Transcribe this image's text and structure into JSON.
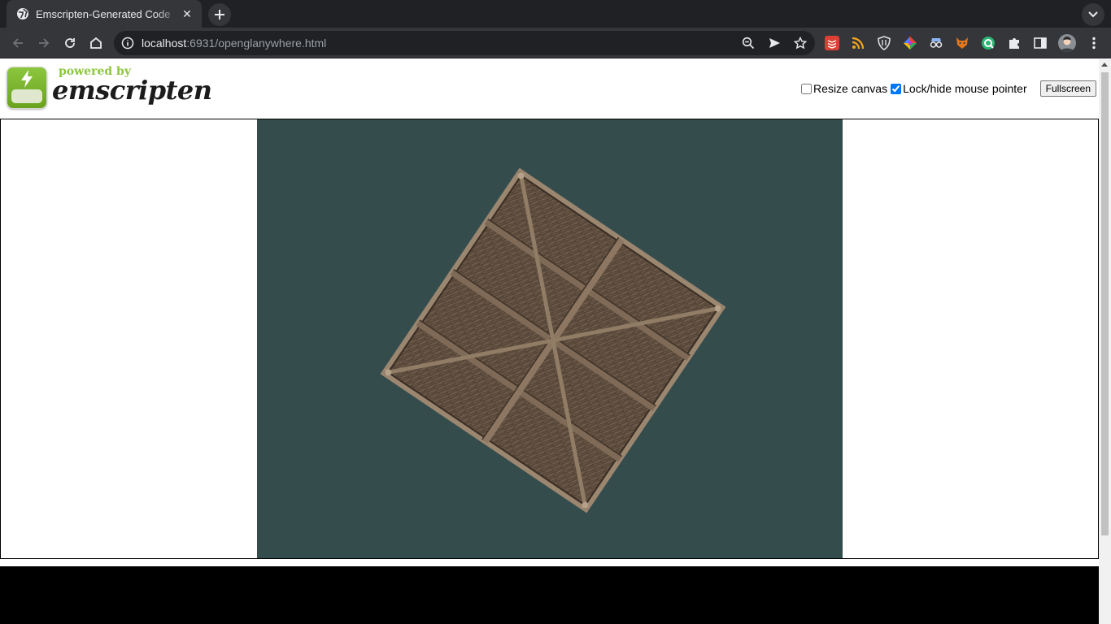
{
  "browser": {
    "tab": {
      "title": "Emscripten-Generated Code",
      "close_glyph": "✕"
    },
    "new_tab_glyph": "+",
    "address": {
      "host": "localhost",
      "rest": ":6931/openglanywhere.html"
    },
    "colors": {
      "tabstrip": "#202124",
      "toolbar": "#35363a",
      "omnibox": "#202124"
    },
    "extensions": [
      "todoist-icon",
      "rss-icon",
      "shield-icon",
      "color-wheel-icon",
      "spy-glasses-icon",
      "fox-icon",
      "green-circle-icon",
      "puzzle-icon",
      "sidepanel-icon",
      "avatar",
      "menu-icon"
    ]
  },
  "page": {
    "logo": {
      "powered": "powered by",
      "name": "emscripten"
    },
    "controls": {
      "resize_label": "Resize canvas",
      "resize_checked": false,
      "lock_label": "Lock/hide mouse pointer",
      "lock_checked": true,
      "fullscreen_label": "Fullscreen"
    },
    "canvas": {
      "background": "#354c4d",
      "content": "rotated wooden crate texture"
    }
  }
}
